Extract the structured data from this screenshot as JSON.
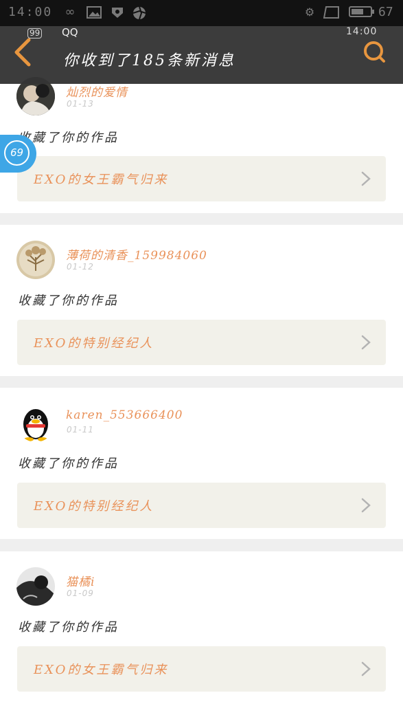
{
  "status_bar": {
    "time": "14:00",
    "battery_level": "67",
    "battery_fraction": 0.67,
    "icons": [
      "infinity-icon",
      "image-icon",
      "shield-icon",
      "aperture-icon",
      "gear-icon",
      "cast-icon",
      "battery-icon"
    ]
  },
  "header": {
    "app_name": "QQ",
    "time": "14:00",
    "badge": "99",
    "title": "你收到了185条新消息",
    "back_icon": "chevron-left-icon",
    "search_icon": "search-icon",
    "accent": "#e9925a"
  },
  "float_badge": {
    "count": "69",
    "color": "#3ea6e6"
  },
  "notifications": [
    {
      "username": "灿烈的爱情",
      "date": "01-13",
      "action": "收藏了你的作品",
      "work": "EXO的女王霸气归来"
    },
    {
      "username": "薄荷的清香_159984060",
      "date": "01-12",
      "action": "收藏了你的作品",
      "work": "EXO的特别经纪人"
    },
    {
      "username": "karen_553666400",
      "date": "01-11",
      "action": "收藏了你的作品",
      "work": "EXO的特别经纪人"
    },
    {
      "username": "猫橘i",
      "date": "01-09",
      "action": "收藏了你的作品",
      "work": "EXO的女王霸气归来"
    }
  ]
}
